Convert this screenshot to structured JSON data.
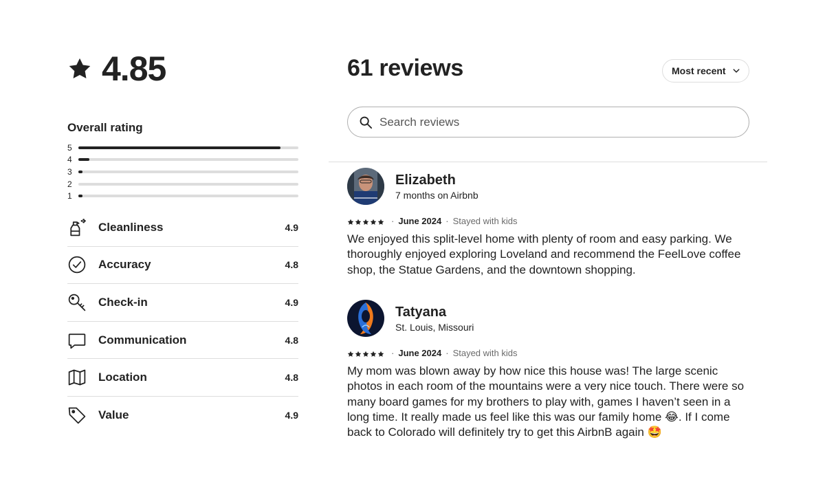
{
  "overall": {
    "rating": "4.85",
    "title": "Overall rating",
    "distribution": [
      {
        "label": "5",
        "fraction": 0.92
      },
      {
        "label": "4",
        "fraction": 0.05
      },
      {
        "label": "3",
        "fraction": 0.02
      },
      {
        "label": "2",
        "fraction": 0.0
      },
      {
        "label": "1",
        "fraction": 0.02
      }
    ]
  },
  "categories": [
    {
      "label": "Cleanliness",
      "score": "4.9",
      "icon": "spray-bottle-icon"
    },
    {
      "label": "Accuracy",
      "score": "4.8",
      "icon": "check-circle-icon"
    },
    {
      "label": "Check-in",
      "score": "4.9",
      "icon": "key-icon"
    },
    {
      "label": "Communication",
      "score": "4.8",
      "icon": "chat-bubble-icon"
    },
    {
      "label": "Location",
      "score": "4.8",
      "icon": "map-icon"
    },
    {
      "label": "Value",
      "score": "4.9",
      "icon": "price-tag-icon"
    }
  ],
  "header": {
    "reviews_count": "61 reviews",
    "sort_label": "Most recent"
  },
  "search": {
    "placeholder": "Search reviews"
  },
  "reviews": [
    {
      "name": "Elizabeth",
      "subtitle": "7 months on Airbnb",
      "date": "June 2024",
      "stay": "Stayed with kids",
      "rating": 5,
      "text": "We enjoyed this split-level home with plenty of room and easy parking. We thoroughly enjoyed exploring Loveland and recommend the FeelLove coffee shop, the Statue Gardens, and the downtown shopping."
    },
    {
      "name": "Tatyana",
      "subtitle": "St. Louis, Missouri",
      "date": "June 2024",
      "stay": "Stayed with kids",
      "rating": 5,
      "text": "My mom was blown away by how nice this house was! The large scenic photos in each room of the mountains were a very nice touch. There were so many board games for my brothers to play with, games I haven’t seen in a long time. It really made us feel like this was our family home 😂. If I come back to Colorado will definitely try to get this AirbnB again 🤩"
    }
  ],
  "colors": {
    "text": "#222222",
    "divider": "#dddddd",
    "muted": "#6a6a6a"
  }
}
